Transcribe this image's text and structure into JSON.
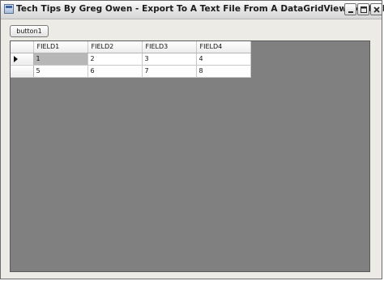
{
  "window": {
    "title": "Tech Tips By Greg Owen - Export To A Text File From  A DataGridView Control"
  },
  "icons": {
    "app": "app-window-icon",
    "minimize": "minimize-icon",
    "maximize": "maximize-icon",
    "close": "close-icon",
    "current_row": "current-row-arrow-icon"
  },
  "toolbar": {
    "button1_label": "button1"
  },
  "grid": {
    "columns": [
      "FIELD1",
      "FIELD2",
      "FIELD3",
      "FIELD4"
    ],
    "rows": [
      [
        "1",
        "2",
        "3",
        "4"
      ],
      [
        "5",
        "6",
        "7",
        "8"
      ]
    ],
    "selected_cell": "1"
  },
  "colors": {
    "grid_background": "#808080",
    "selected_cell": "#b7b7b7",
    "window_background": "#ecebe6"
  }
}
